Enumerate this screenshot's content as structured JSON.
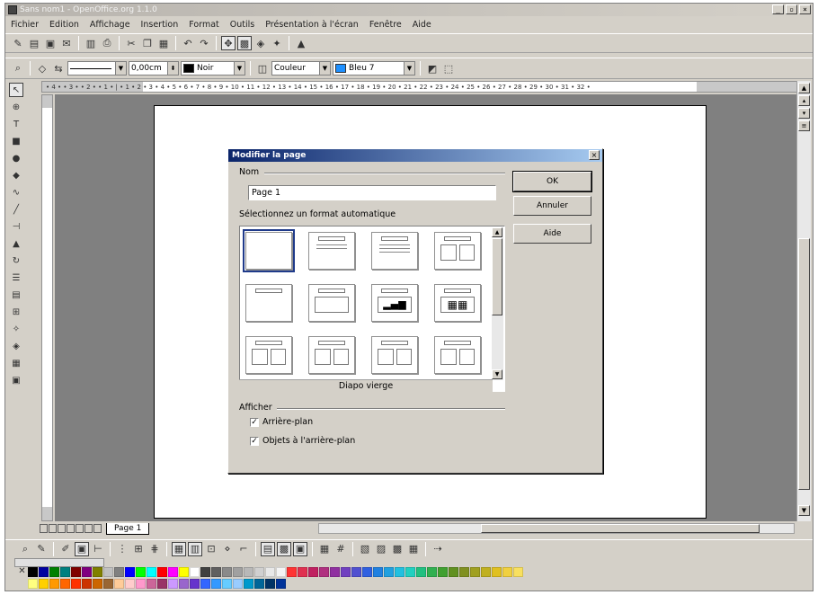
{
  "window": {
    "title": "Sans nom1 - OpenOffice.org 1.1.0"
  },
  "menu": [
    "Fichier",
    "Edition",
    "Affichage",
    "Insertion",
    "Format",
    "Outils",
    "Présentation à l'écran",
    "Fenêtre",
    "Aide"
  ],
  "toolbar2": {
    "line_width": "0,00cm",
    "line_color": "Noir",
    "fill_mode": "Couleur",
    "fill_color": "Bleu 7"
  },
  "ruler_text": "• 4 • • 3 • • 2 • • 1 • | • 1 • 2 • 3 • 4 • 5 • 6 • 7 • 8 • 9 • 10 • 11 • 12 • 13 • 14 • 15 • 16 • 17 • 18 • 19 • 20 • 21 • 22 • 23 • 24 • 25 • 26 • 27 • 28 • 29 • 30 • 31 • 32 •",
  "tabs": {
    "page_tab": "Page 1"
  },
  "dialog": {
    "title": "Modifier la page",
    "name_label": "Nom",
    "name_value": "Page 1",
    "layout_label": "Sélectionnez un format automatique",
    "layout_caption": "Diapo vierge",
    "display_label": "Afficher",
    "chk_background": "Arrière-plan",
    "chk_background_objects": "Objets à l'arrière-plan",
    "ok": "OK",
    "cancel": "Annuler",
    "help": "Aide"
  },
  "colors": {
    "row1": [
      "#000000",
      "#0000a0",
      "#008000",
      "#008080",
      "#800000",
      "#800080",
      "#808000",
      "#c0c0c0",
      "#808080",
      "#0000ff",
      "#00ff00",
      "#00ffff",
      "#ff0000",
      "#ff00ff",
      "#ffff00",
      "#ffffff",
      "#404040",
      "#606060",
      "#8a8a8a",
      "#a0a0a0",
      "#b8b8b8",
      "#d0d0d0",
      "#e8e8e8",
      "#f4f4f4",
      "#ff3333",
      "#e03050",
      "#c02060",
      "#b03080",
      "#9030a0",
      "#7040c0",
      "#5050d0",
      "#3060e0",
      "#2080e0",
      "#20a0e0",
      "#20c0e0",
      "#20d0c0",
      "#20c080",
      "#30b050",
      "#40a030",
      "#609020",
      "#809020",
      "#a0a020",
      "#c0b020",
      "#e0c020",
      "#f0d040",
      "#f8e060"
    ],
    "row2": [
      "#ffff80",
      "#ffd000",
      "#ff9900",
      "#ff6600",
      "#ff3300",
      "#cc3300",
      "#cc6600",
      "#996633",
      "#ffcc99",
      "#ffcccc",
      "#ff99cc",
      "#cc6699",
      "#993366",
      "#cc99ff",
      "#9966cc",
      "#6633cc",
      "#3366ff",
      "#3399ff",
      "#66ccff",
      "#99ccff",
      "#0099cc",
      "#006699",
      "#003366",
      "#003399"
    ]
  }
}
